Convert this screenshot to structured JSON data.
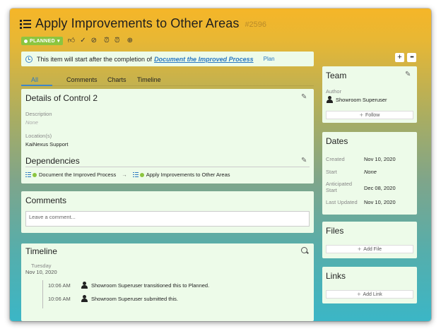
{
  "header": {
    "title": "Apply Improvements to Other Areas",
    "item_id": "#2596",
    "status": "PLANNED",
    "tool_icons": [
      "thumbs-up-icon",
      "checkmark-circle-icon",
      "stop-circle-icon",
      "alarm-clock-icon",
      "alarm-clock-icon",
      "zoom-in-icon"
    ]
  },
  "banner": {
    "text": "This item will start after the completion of",
    "link": "Document the Improved Process",
    "action": "Plan"
  },
  "tabs": [
    "All",
    "Comments",
    "Charts",
    "Timeline"
  ],
  "details": {
    "title": "Details of Control 2",
    "description_label": "Description",
    "description_value": "None",
    "locations_label": "Location(s)",
    "locations_value": "KaiNexus Support",
    "dependencies_title": "Dependencies",
    "dep_from": "Document the Improved Process",
    "dep_to": "Apply Improvements to Other Areas"
  },
  "comments": {
    "title": "Comments",
    "placeholder": "Leave a comment..."
  },
  "timeline": {
    "title": "Timeline",
    "day": "Tuesday",
    "date": "Nov 10, 2020",
    "events": [
      {
        "time": "10:06 AM",
        "text": "Showroom Superuser transitioned this to Planned."
      },
      {
        "time": "10:06 AM",
        "text": "Showroom Superuser submitted this."
      }
    ]
  },
  "team": {
    "title": "Team",
    "author_label": "Author",
    "author": "Showroom Superuser",
    "follow": "Follow"
  },
  "dates": {
    "title": "Dates",
    "rows": [
      {
        "label": "Created",
        "value": "Nov 10, 2020",
        "italic": false
      },
      {
        "label": "Start",
        "value": "None",
        "italic": true
      },
      {
        "label": "Anticipated\nStart",
        "value": "Dec 08, 2020",
        "italic": false
      },
      {
        "label": "Last Updated",
        "value": "Nov 10, 2020",
        "italic": false
      }
    ]
  },
  "files": {
    "title": "Files",
    "add": "Add File"
  },
  "links": {
    "title": "Links",
    "add": "Add Link"
  },
  "side_actions": {
    "add": "+",
    "more": "•••"
  },
  "colors": {
    "accent": "#3f86c8",
    "status_green": "#8bc53f",
    "card_bg": "#edfbe9"
  }
}
